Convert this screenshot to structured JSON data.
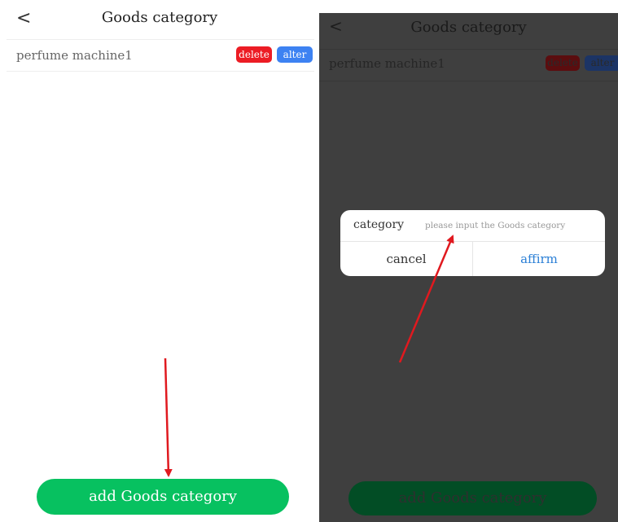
{
  "left_screen": {
    "nav": {
      "back_icon": "chevron-left-icon",
      "back_glyph": "<",
      "title": "Goods category"
    },
    "list": [
      {
        "label": "perfume machine1",
        "delete_label": "delete",
        "alter_label": "alter"
      }
    ],
    "add_button_label": "add Goods category"
  },
  "right_screen": {
    "nav": {
      "back_glyph": "<",
      "title": "Goods category"
    },
    "list": [
      {
        "label": "perfume machine1",
        "delete_label": "delete",
        "alter_label": "alter"
      }
    ],
    "add_button_label": "add Goods category",
    "dialog": {
      "field_label": "category",
      "input_value": "",
      "input_placeholder": "please input the Goods category",
      "cancel_label": "cancel",
      "affirm_label": "affirm"
    }
  },
  "colors": {
    "delete": "#ec1c24",
    "alter": "#3d82f2",
    "add_button": "#07c160",
    "affirm_text": "#2a7fd6",
    "annotation_arrow": "#e0191f",
    "mask_overlay": "#3f3f3f"
  },
  "annotations": [
    {
      "type": "arrow",
      "icon": "red-arrow-icon",
      "points_to": "add Goods category button"
    },
    {
      "type": "arrow",
      "icon": "red-arrow-icon",
      "points_to": "category input field"
    }
  ]
}
